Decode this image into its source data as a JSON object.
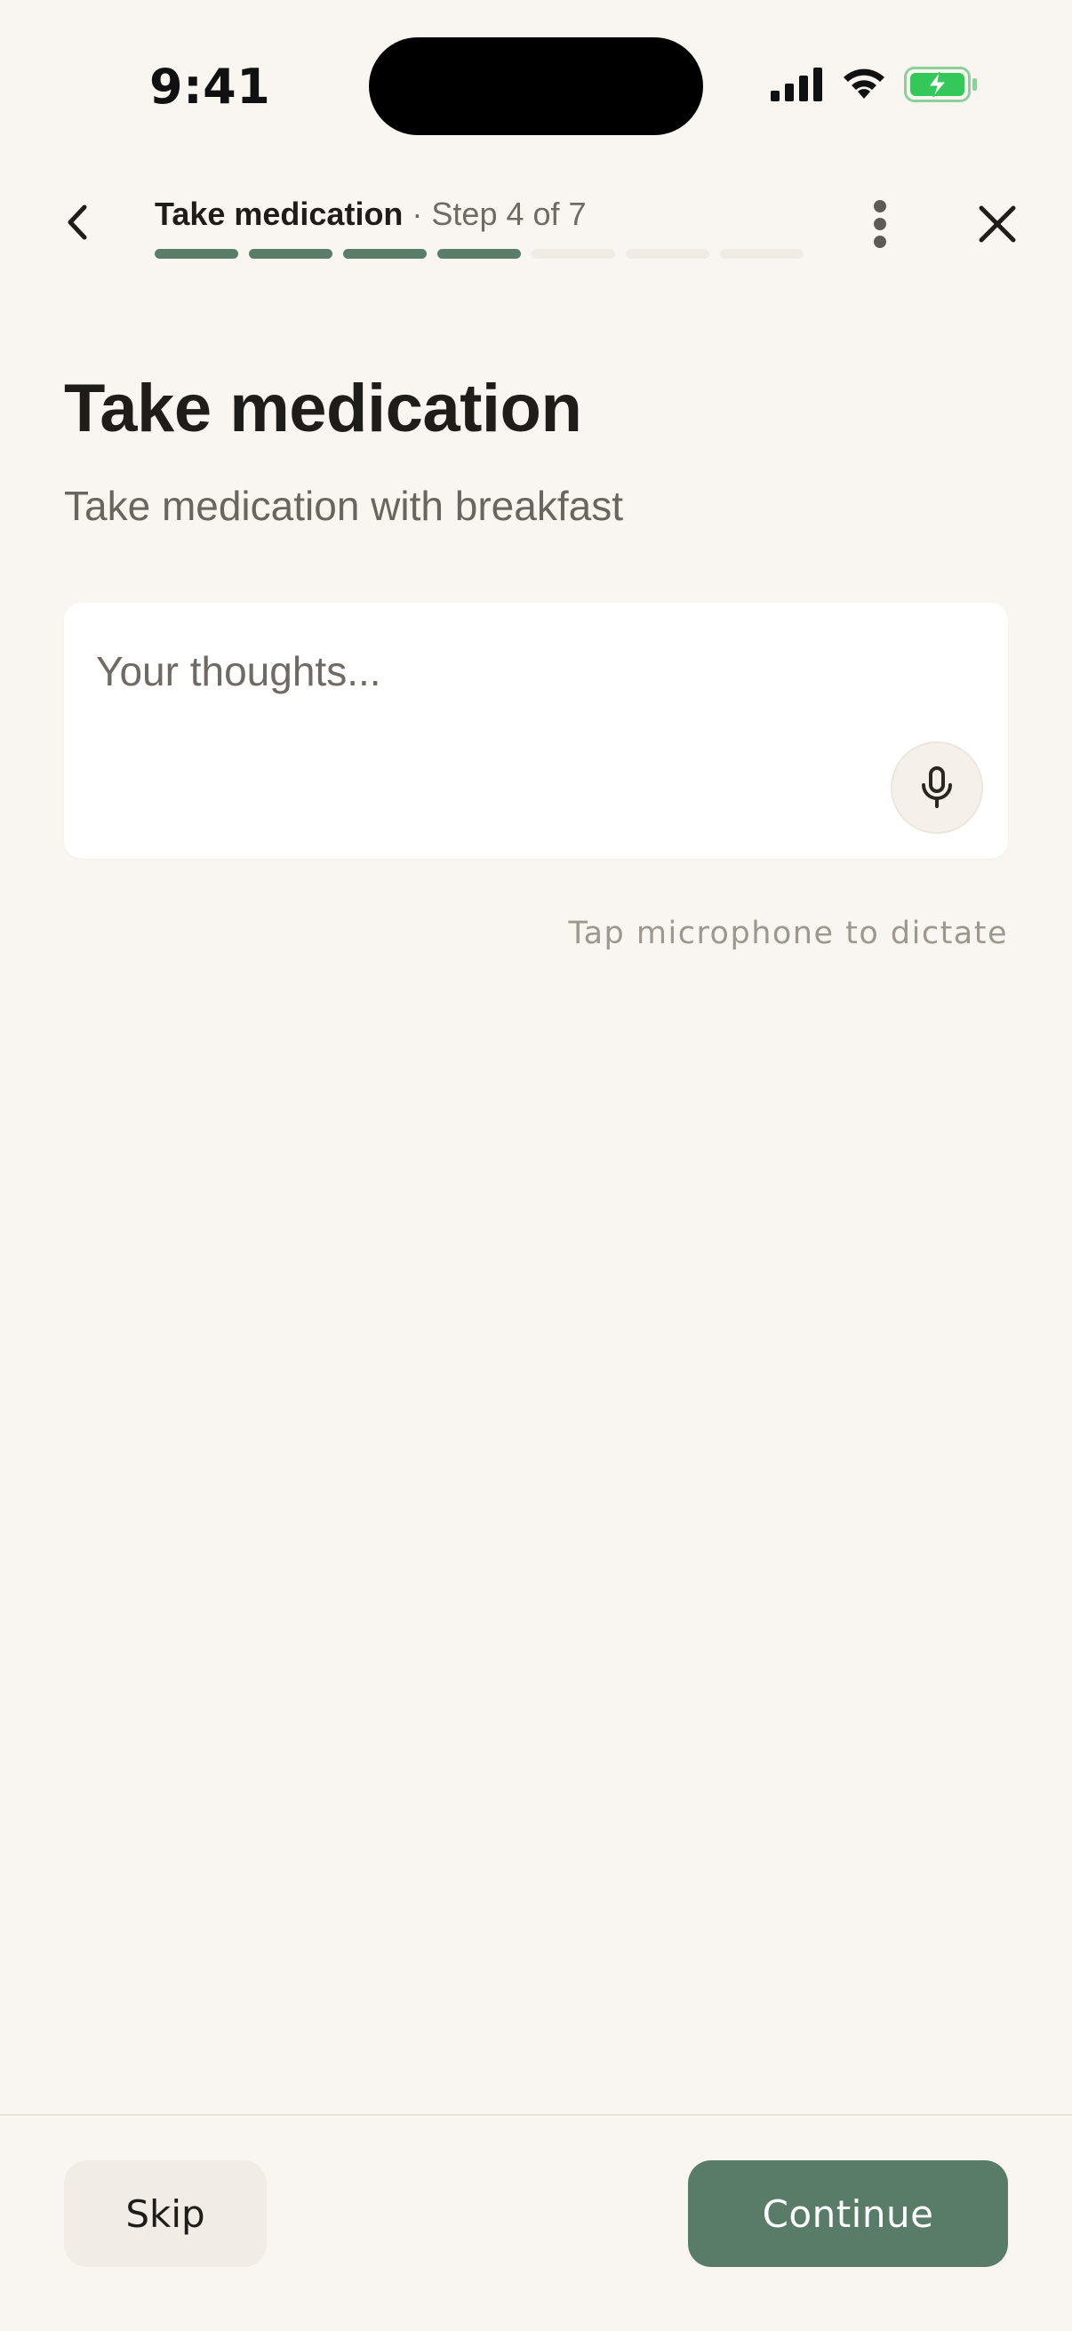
{
  "status_bar": {
    "time": "9:41",
    "icons": [
      "cellular-signal-icon",
      "wifi-icon",
      "battery-charging-icon"
    ],
    "battery_color": "#34c759"
  },
  "header": {
    "back_icon": "chevron-left-icon",
    "task_name": "Take medication",
    "step_text": " · Step 4 of 7",
    "progress": {
      "current_step": 4,
      "total_steps": 7
    },
    "more_icon": "more-vertical-icon",
    "close_icon": "close-icon"
  },
  "content": {
    "title": "Take medication",
    "subtitle": "Take medication with breakfast",
    "thoughts": {
      "value": "",
      "placeholder": "Your thoughts..."
    },
    "mic_icon": "microphone-icon",
    "dictate_hint": "Tap microphone to dictate"
  },
  "footer": {
    "skip_label": "Skip",
    "continue_label": "Continue"
  },
  "colors": {
    "background": "#f9f6f1",
    "accent": "#587c68",
    "progress_inactive": "#f0ebe3"
  }
}
